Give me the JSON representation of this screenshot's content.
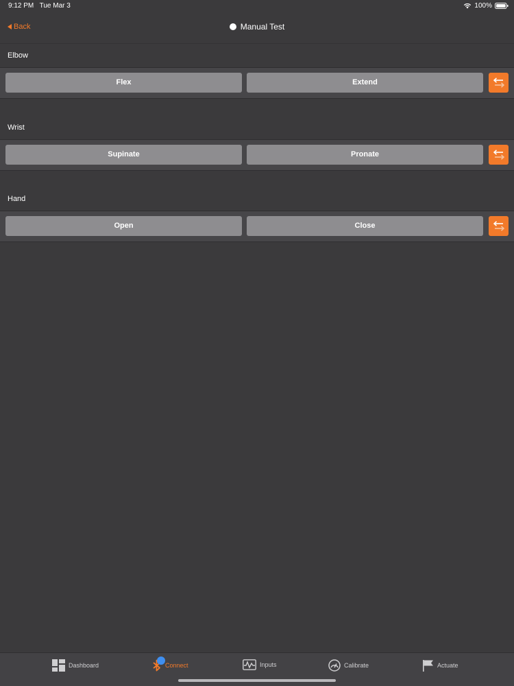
{
  "status_bar": {
    "time": "9:12 PM",
    "date": "Tue Mar 3",
    "battery": "100%"
  },
  "nav": {
    "back_label": "Back",
    "title": "Manual Test"
  },
  "sections": [
    {
      "title": "Elbow",
      "left_label": "Flex",
      "right_label": "Extend"
    },
    {
      "title": "Wrist",
      "left_label": "Supinate",
      "right_label": "Pronate"
    },
    {
      "title": "Hand",
      "left_label": "Open",
      "right_label": "Close"
    }
  ],
  "tabs": [
    {
      "label": "Dashboard",
      "icon": "dashboard-icon"
    },
    {
      "label": "Connect",
      "icon": "bluetooth-icon",
      "active": true
    },
    {
      "label": "Inputs",
      "icon": "waveform-icon"
    },
    {
      "label": "Calibrate",
      "icon": "gauge-icon"
    },
    {
      "label": "Actuate",
      "icon": "flag-icon"
    }
  ],
  "colors": {
    "accent": "#f27a2a",
    "background": "#3b3a3c",
    "button": "#8e8d90",
    "badge": "#3f8ff0"
  }
}
